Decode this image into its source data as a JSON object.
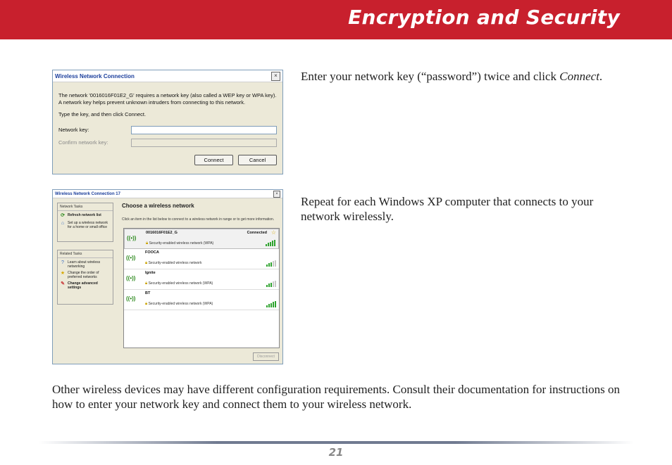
{
  "header": {
    "title": "Encryption and Security"
  },
  "text": {
    "p1_main": "Enter your network key (“password”) twice and click ",
    "p1_em": "Connect",
    "p1_end": ".",
    "p2": "Repeat for each Windows XP computer that connects to your network wirelessly.",
    "p3": "Other wireless devices may have different configuration requirements.  Consult their documentation for instructions on how to enter your network key and connect them to your wireless network."
  },
  "dialog1": {
    "title": "Wireless Network Connection",
    "close": "×",
    "message": "The network '0016016F01E2_G' requires a network key (also called a WEP key or WPA key). A network key helps prevent unknown intruders from connecting to this network.",
    "instruction": "Type the key, and then click Connect.",
    "key_label": "Network key:",
    "confirm_label": "Confirm network key:",
    "connect": "Connect",
    "cancel": "Cancel"
  },
  "dialog2": {
    "title": "Wireless Network Connection 17",
    "close": "×",
    "network_tasks": "Network Tasks",
    "refresh": "Refresh network list",
    "setup": "Set up a wireless network for a home or small office",
    "related_tasks": "Related Tasks",
    "learn": "Learn about wireless networking",
    "order": "Change the order of preferred networks",
    "advanced": "Change advanced settings",
    "heading": "Choose a wireless network",
    "desc": "Click an item in the list below to connect to a wireless network in range or to get more information.",
    "networks": [
      {
        "ssid": "0016016F01E2_G",
        "security": "Security-enabled wireless network (WPA)",
        "status": "Connected",
        "signal": 5
      },
      {
        "ssid": "FOOCA",
        "security": "Security-enabled wireless network",
        "status": "",
        "signal": 3
      },
      {
        "ssid": "Ignite",
        "security": "Security-enabled wireless network (WPA)",
        "status": "",
        "signal": 3
      },
      {
        "ssid": "BT",
        "security": "Security-enabled wireless network (WPA)",
        "status": "",
        "signal": 5
      }
    ],
    "disconnect": "Disconnect"
  },
  "footer": {
    "page": "21"
  },
  "colors": {
    "banner": "#c8202d",
    "accent_green": "#2ea32e"
  }
}
